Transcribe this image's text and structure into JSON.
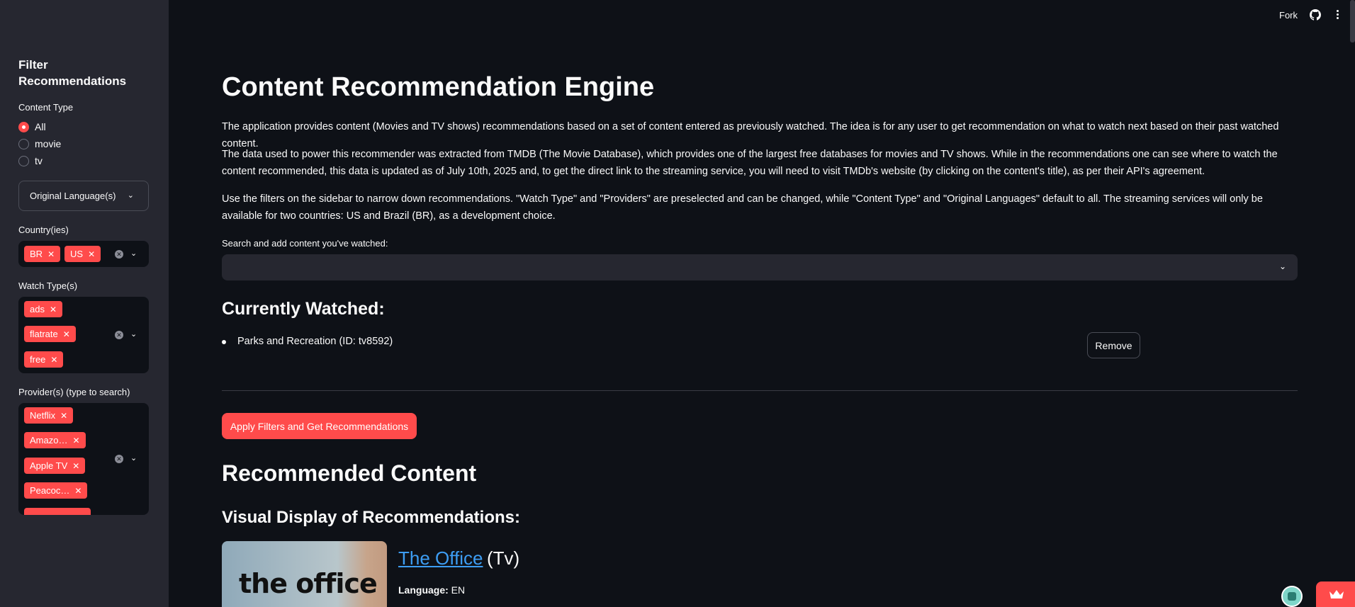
{
  "header": {
    "fork_label": "Fork",
    "icons": [
      "github-icon",
      "menu-icon"
    ]
  },
  "sidebar": {
    "title": "Filter Recommendations",
    "content_type": {
      "label": "Content Type",
      "options": [
        "All",
        "movie",
        "tv"
      ],
      "selected": "All"
    },
    "original_language": {
      "placeholder": "Original Language(s)"
    },
    "countries": {
      "label": "Country(ies)",
      "tags": [
        "BR",
        "US"
      ]
    },
    "watch_types": {
      "label": "Watch Type(s)",
      "tags": [
        "ads",
        "flatrate",
        "free"
      ]
    },
    "providers": {
      "label": "Provider(s) (type to search)",
      "tags": [
        "Netflix",
        "Amazo…",
        "Apple TV",
        "Peacoc…"
      ]
    }
  },
  "main": {
    "title": "Content Recommendation Engine",
    "paragraphs": [
      "The application provides content (Movies and TV shows) recommendations based on a set of content entered as previously watched. The idea is for any user to get recommendation on what to watch next based on their past watched content.",
      "The data used to power this recommender was extracted from TMDB (The Movie Database), which provides one of the largest free databases for movies and TV shows. While in the recommendations one can see where to watch the content recommended, this data is updated as of July 10th, 2025 and, to get the direct link to the streaming service, you will need to visit TMDb's website (by clicking on the content's title), as per their API's agreement.",
      "Use the filters on the sidebar to narrow down recommendations. \"Watch Type\" and \"Providers\" are preselected and can be changed, while \"Content Type\" and \"Original Languages\" default to all. The streaming services will only be available for two countries: US and Brazil (BR), as a development choice."
    ],
    "search_label": "Search and add content you've watched:",
    "currently_watched_heading": "Currently Watched:",
    "watched_items": [
      "Parks and Recreation (ID: tv8592)"
    ],
    "remove_label": "Remove",
    "apply_label": "Apply Filters and Get Recommendations",
    "recommended_heading": "Recommended Content",
    "visual_heading": "Visual Display of Recommendations:",
    "recommendations": [
      {
        "poster_text": "the office",
        "title": "The Office",
        "type": "(Tv)",
        "language_label": "Language:",
        "language": "EN"
      }
    ]
  },
  "colors": {
    "background": "#0e1117",
    "sidebar": "#262730",
    "accent": "#ff4b4b",
    "link": "#3d9df3"
  }
}
